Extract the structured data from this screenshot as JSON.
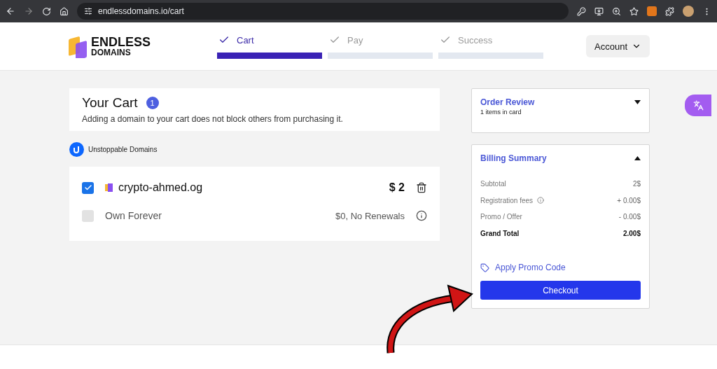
{
  "browser": {
    "url": "endlessdomains.io/cart"
  },
  "logo": {
    "line1": "ENDLESS",
    "line2": "DOMAINS"
  },
  "steps": [
    {
      "label": "Cart",
      "selected": true
    },
    {
      "label": "Pay",
      "selected": false
    },
    {
      "label": "Success",
      "selected": false
    }
  ],
  "account_button": "Account",
  "cart": {
    "title": "Your Cart",
    "count": "1",
    "note": "Adding a domain to your cart does not block others from purchasing it."
  },
  "provider": "Unstoppable Domains",
  "items": [
    {
      "kind": "domain",
      "checked": true,
      "name": "crypto-ahmed.og",
      "price": "$ 2"
    },
    {
      "kind": "option",
      "checked": false,
      "name": "Own Forever",
      "price": "$0, No Renewals"
    }
  ],
  "order_review": {
    "title": "Order Review",
    "subtitle": "1 items in card",
    "expanded": false
  },
  "billing": {
    "title": "Billing Summary",
    "expanded": true,
    "rows": [
      {
        "kind": "normal",
        "label": "Subtotal",
        "value": "2$",
        "info": false
      },
      {
        "kind": "normal",
        "label": "Registration fees",
        "value": "+ 0.00$",
        "info": true
      },
      {
        "kind": "normal",
        "label": "Promo / Offer",
        "value": "- 0.00$",
        "info": false
      },
      {
        "kind": "total",
        "label": "Grand Total",
        "value": "2.00$",
        "info": false
      }
    ],
    "promo": "Apply Promo Code",
    "checkout": "Checkout"
  }
}
